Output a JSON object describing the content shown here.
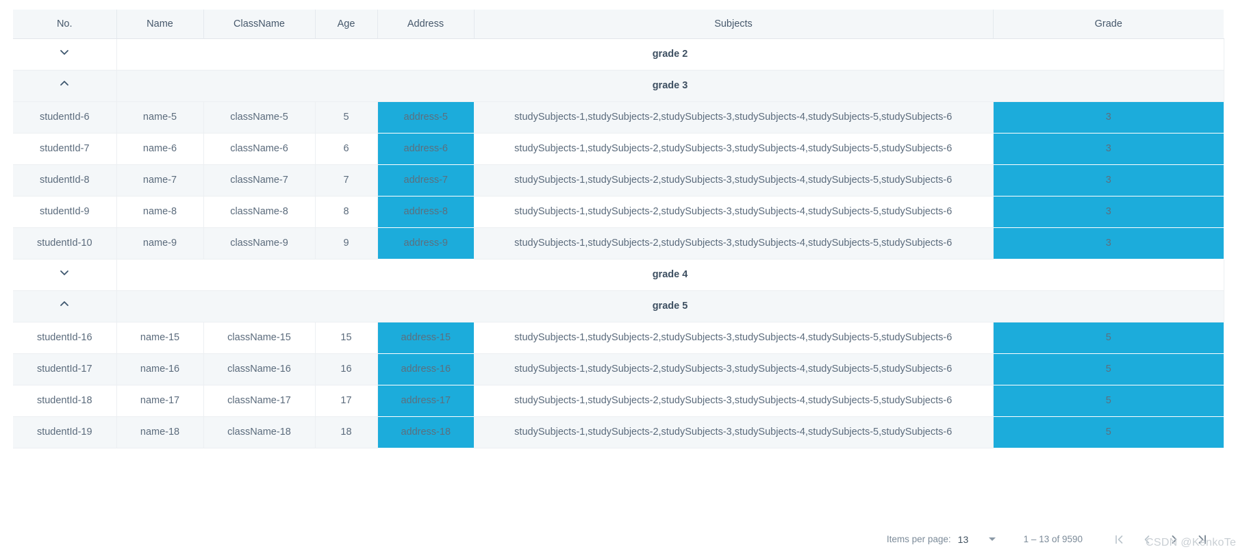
{
  "table": {
    "columns": [
      {
        "key": "no",
        "label": "No."
      },
      {
        "key": "name",
        "label": "Name"
      },
      {
        "key": "class",
        "label": "ClassName"
      },
      {
        "key": "age",
        "label": "Age"
      },
      {
        "key": "address",
        "label": "Address"
      },
      {
        "key": "subjects",
        "label": "Subjects"
      },
      {
        "key": "grade",
        "label": "Grade"
      }
    ],
    "highlight_color": "#1cacdb",
    "rows": [
      {
        "type": "group",
        "label": "grade 2",
        "expanded": false,
        "icon": "chevron-down-icon",
        "stripe": "even"
      },
      {
        "type": "group",
        "label": "grade 3",
        "expanded": true,
        "icon": "chevron-up-icon",
        "stripe": "odd"
      },
      {
        "type": "data",
        "stripe": "odd",
        "no": "studentId-6",
        "name": "name-5",
        "class": "className-5",
        "age": "5",
        "address": "address-5",
        "subjects": "studySubjects-1,studySubjects-2,studySubjects-3,studySubjects-4,studySubjects-5,studySubjects-6",
        "grade": "3"
      },
      {
        "type": "data",
        "stripe": "even",
        "no": "studentId-7",
        "name": "name-6",
        "class": "className-6",
        "age": "6",
        "address": "address-6",
        "subjects": "studySubjects-1,studySubjects-2,studySubjects-3,studySubjects-4,studySubjects-5,studySubjects-6",
        "grade": "3"
      },
      {
        "type": "data",
        "stripe": "odd",
        "no": "studentId-8",
        "name": "name-7",
        "class": "className-7",
        "age": "7",
        "address": "address-7",
        "subjects": "studySubjects-1,studySubjects-2,studySubjects-3,studySubjects-4,studySubjects-5,studySubjects-6",
        "grade": "3"
      },
      {
        "type": "data",
        "stripe": "even",
        "no": "studentId-9",
        "name": "name-8",
        "class": "className-8",
        "age": "8",
        "address": "address-8",
        "subjects": "studySubjects-1,studySubjects-2,studySubjects-3,studySubjects-4,studySubjects-5,studySubjects-6",
        "grade": "3"
      },
      {
        "type": "data",
        "stripe": "odd",
        "no": "studentId-10",
        "name": "name-9",
        "class": "className-9",
        "age": "9",
        "address": "address-9",
        "subjects": "studySubjects-1,studySubjects-2,studySubjects-3,studySubjects-4,studySubjects-5,studySubjects-6",
        "grade": "3"
      },
      {
        "type": "group",
        "label": "grade 4",
        "expanded": false,
        "icon": "chevron-down-icon",
        "stripe": "even"
      },
      {
        "type": "group",
        "label": "grade 5",
        "expanded": true,
        "icon": "chevron-up-icon",
        "stripe": "odd"
      },
      {
        "type": "data",
        "stripe": "even",
        "no": "studentId-16",
        "name": "name-15",
        "class": "className-15",
        "age": "15",
        "address": "address-15",
        "subjects": "studySubjects-1,studySubjects-2,studySubjects-3,studySubjects-4,studySubjects-5,studySubjects-6",
        "grade": "5"
      },
      {
        "type": "data",
        "stripe": "odd",
        "no": "studentId-17",
        "name": "name-16",
        "class": "className-16",
        "age": "16",
        "address": "address-16",
        "subjects": "studySubjects-1,studySubjects-2,studySubjects-3,studySubjects-4,studySubjects-5,studySubjects-6",
        "grade": "5"
      },
      {
        "type": "data",
        "stripe": "even",
        "no": "studentId-18",
        "name": "name-17",
        "class": "className-17",
        "age": "17",
        "address": "address-17",
        "subjects": "studySubjects-1,studySubjects-2,studySubjects-3,studySubjects-4,studySubjects-5,studySubjects-6",
        "grade": "5"
      },
      {
        "type": "data",
        "stripe": "odd",
        "no": "studentId-19",
        "name": "name-18",
        "class": "className-18",
        "age": "18",
        "address": "address-18",
        "subjects": "studySubjects-1,studySubjects-2,studySubjects-3,studySubjects-4,studySubjects-5,studySubjects-6",
        "grade": "5"
      }
    ]
  },
  "paginator": {
    "items_per_page_label": "Items per page:",
    "items_per_page_value": "13",
    "range_label": "1 – 13 of 9590",
    "buttons": [
      {
        "name": "first-page-button",
        "icon": "first-page-icon",
        "disabled": true
      },
      {
        "name": "previous-page-button",
        "icon": "chevron-left-icon",
        "disabled": true
      },
      {
        "name": "next-page-button",
        "icon": "chevron-right-icon",
        "disabled": false
      },
      {
        "name": "last-page-button",
        "icon": "last-page-icon",
        "disabled": false
      }
    ]
  },
  "watermark": {
    "text": "CSDN @KenkoTech"
  }
}
